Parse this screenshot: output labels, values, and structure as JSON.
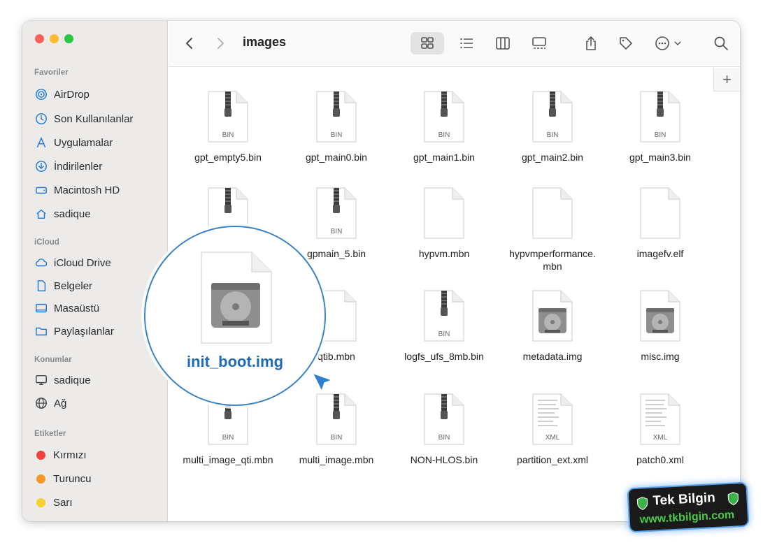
{
  "window": {
    "title": "images"
  },
  "sidebar": {
    "sections": [
      {
        "label": "Favoriler",
        "items": [
          {
            "label": "AirDrop",
            "icon": "airdrop-icon"
          },
          {
            "label": "Son Kullanılanlar",
            "icon": "clock-icon"
          },
          {
            "label": "Uygulamalar",
            "icon": "apps-icon"
          },
          {
            "label": "İndirilenler",
            "icon": "download-icon"
          },
          {
            "label": "Macintosh HD",
            "icon": "drive-icon"
          },
          {
            "label": "sadique",
            "icon": "home-icon"
          }
        ]
      },
      {
        "label": "iCloud",
        "items": [
          {
            "label": "iCloud Drive",
            "icon": "cloud-icon"
          },
          {
            "label": "Belgeler",
            "icon": "document-icon"
          },
          {
            "label": "Masaüstü",
            "icon": "desktop-icon"
          },
          {
            "label": "Paylaşılanlar",
            "icon": "shared-folder-icon"
          }
        ]
      },
      {
        "label": "Konumlar",
        "items": [
          {
            "label": "sadique",
            "icon": "computer-icon"
          },
          {
            "label": "Ağ",
            "icon": "globe-icon"
          }
        ]
      },
      {
        "label": "Etiketler",
        "items": [
          {
            "label": "Kırmızı",
            "color": "#f0423c"
          },
          {
            "label": "Turuncu",
            "color": "#f7962a"
          },
          {
            "label": "Sarı",
            "color": "#f8cf2c"
          }
        ]
      }
    ]
  },
  "toolbar": {
    "back_icon": "chevron-left-icon",
    "forward_icon": "chevron-right-icon",
    "views": [
      "icon-view-icon",
      "list-view-icon",
      "column-view-icon",
      "gallery-view-icon"
    ],
    "actions": [
      "share-icon",
      "tag-icon",
      "more-icon",
      "search-icon"
    ],
    "plus_label": "+"
  },
  "files": [
    {
      "name": "gpt_empty5.bin",
      "type": "BIN",
      "kind": "zip"
    },
    {
      "name": "gpt_main0.bin",
      "type": "BIN",
      "kind": "zip"
    },
    {
      "name": "gpt_main1.bin",
      "type": "BIN",
      "kind": "zip"
    },
    {
      "name": "gpt_main2.bin",
      "type": "BIN",
      "kind": "zip"
    },
    {
      "name": "gpt_main3.bin",
      "type": "BIN",
      "kind": "zip"
    },
    {
      "name": "",
      "type": "",
      "kind": "zip"
    },
    {
      "name": "gpmain_5.bin",
      "type": "BIN",
      "kind": "zip"
    },
    {
      "name": "hypvm.mbn",
      "type": "",
      "kind": "blank"
    },
    {
      "name": "hypvmperformance.\nmbn",
      "type": "",
      "kind": "blank"
    },
    {
      "name": "imagefv.elf",
      "type": "",
      "kind": "blank"
    },
    {
      "name": "",
      "type": "",
      "kind": "hidden"
    },
    {
      "name": "qtib.mbn",
      "type": "",
      "kind": "blank"
    },
    {
      "name": "logfs_ufs_8mb.bin",
      "type": "BIN",
      "kind": "zip"
    },
    {
      "name": "metadata.img",
      "type": "",
      "kind": "disk"
    },
    {
      "name": "misc.img",
      "type": "",
      "kind": "disk"
    },
    {
      "name": "multi_image_qti.mbn",
      "type": "BIN",
      "kind": "zip"
    },
    {
      "name": "multi_image.mbn",
      "type": "BIN",
      "kind": "zip"
    },
    {
      "name": "NON-HLOS.bin",
      "type": "BIN",
      "kind": "zip"
    },
    {
      "name": "partition_ext.xml",
      "type": "XML",
      "kind": "text"
    },
    {
      "name": "patch0.xml",
      "type": "XML",
      "kind": "text"
    }
  ],
  "magnifier": {
    "name": "init_boot.img",
    "icon": "disk-image-icon"
  },
  "watermark": {
    "title": "Tek Bilgin",
    "url": "www.tkbilgin.com"
  },
  "colors": {
    "accent": "#1f7ad9",
    "highlight": "#1e6bb8"
  }
}
